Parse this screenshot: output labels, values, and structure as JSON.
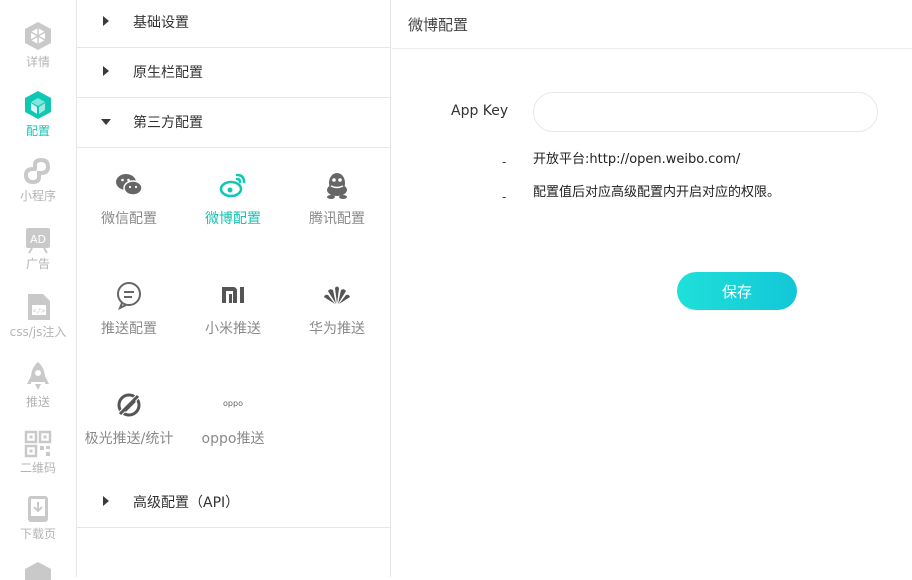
{
  "rail": {
    "items": [
      {
        "label": "详情",
        "icon": "cube-outline-icon"
      },
      {
        "label": "配置",
        "icon": "cube-solid-icon",
        "active": true
      },
      {
        "label": "小程序",
        "icon": "miniapp-icon"
      },
      {
        "label": "广告",
        "icon": "ad-icon"
      },
      {
        "label": "css/js注入",
        "icon": "code-file-icon"
      },
      {
        "label": "推送",
        "icon": "rocket-icon"
      },
      {
        "label": "二维码",
        "icon": "qrcode-icon"
      },
      {
        "label": "下载页",
        "icon": "download-page-icon"
      }
    ]
  },
  "menu": {
    "sections": [
      {
        "label": "基础设置",
        "expanded": false
      },
      {
        "label": "原生栏配置",
        "expanded": false
      },
      {
        "label": "第三方配置",
        "expanded": true
      },
      {
        "label": "高级配置（API）",
        "expanded": false
      }
    ],
    "third_party": [
      {
        "label": "微信配置",
        "icon": "wechat-icon"
      },
      {
        "label": "微博配置",
        "icon": "weibo-icon",
        "active": true
      },
      {
        "label": "腾讯配置",
        "icon": "qq-icon"
      },
      {
        "label": "推送配置",
        "icon": "chat-bubble-icon"
      },
      {
        "label": "小米推送",
        "icon": "xiaomi-icon"
      },
      {
        "label": "华为推送",
        "icon": "huawei-icon"
      },
      {
        "label": "极光推送/统计",
        "icon": "jpush-icon"
      },
      {
        "label": "oppo推送",
        "icon": "oppo-icon",
        "logo_text": "oppo"
      }
    ]
  },
  "content": {
    "title": "微博配置",
    "field_label": "App Key",
    "field_value": "",
    "hint1": "开放平台:http://open.weibo.com/",
    "hint2": "配置值后对应高级配置内开启对应的权限。",
    "save_label": "保存"
  },
  "colors": {
    "accent": "#10c7b4",
    "button": "#15d3d8",
    "muted": "#b4b4b4"
  }
}
